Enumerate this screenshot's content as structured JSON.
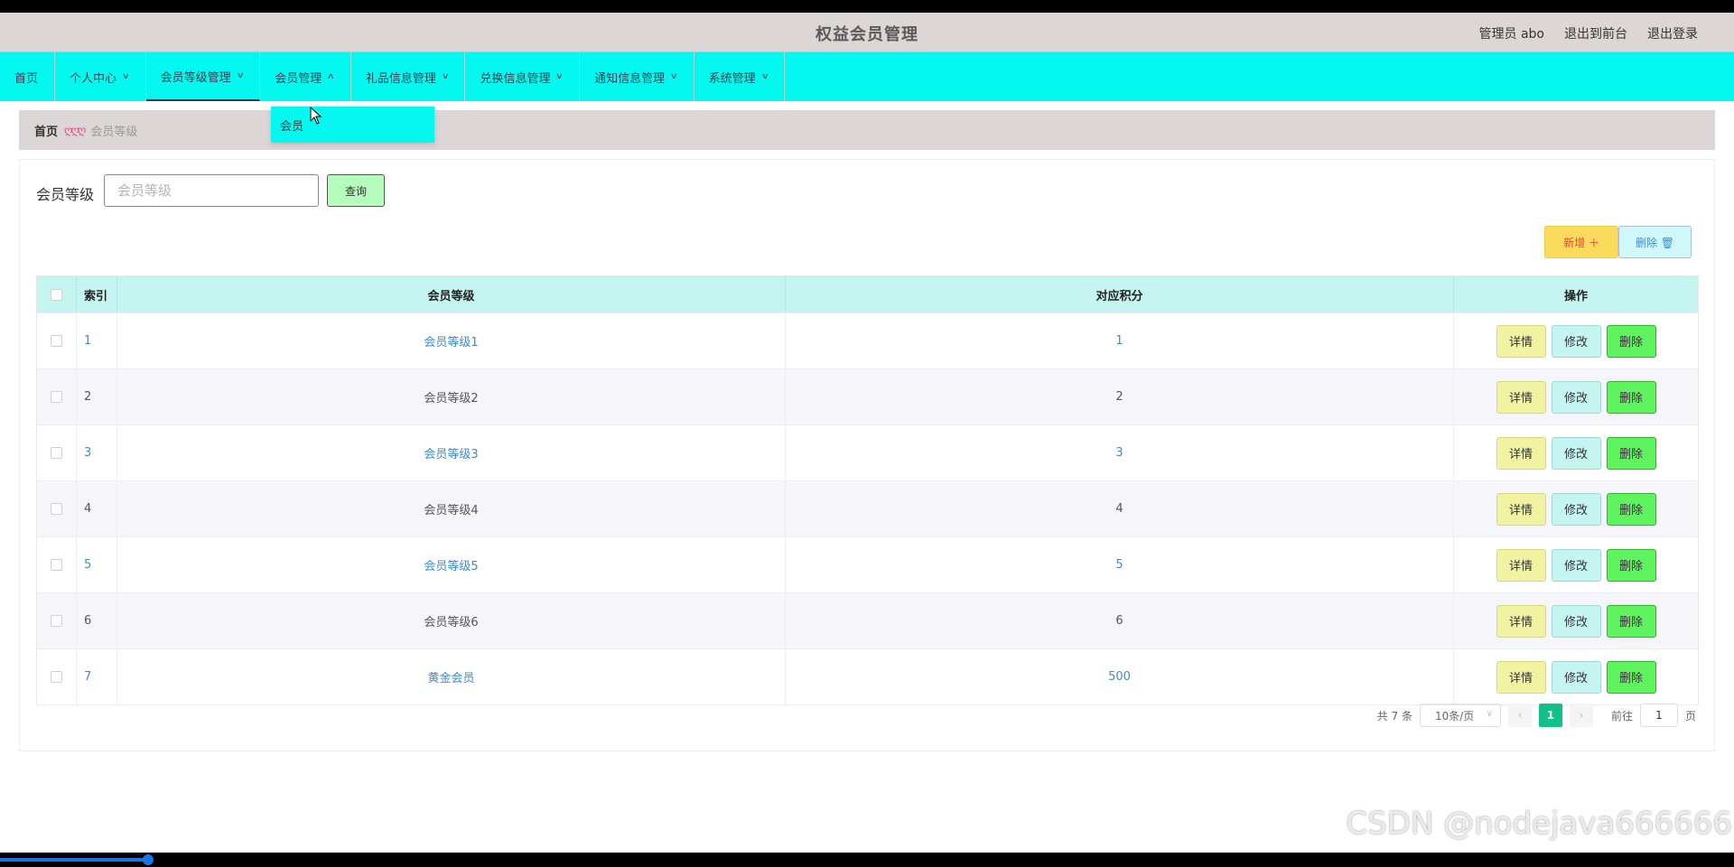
{
  "header": {
    "title": "权益会员管理",
    "admin": "管理员 abo",
    "to_front": "退出到前台",
    "logout": "退出登录"
  },
  "nav": {
    "items": [
      {
        "label": "首页"
      },
      {
        "label": "个人中心"
      },
      {
        "label": "会员等级管理"
      },
      {
        "label": "会员管理"
      },
      {
        "label": "礼品信息管理"
      },
      {
        "label": "兑换信息管理"
      },
      {
        "label": "通知信息管理"
      },
      {
        "label": "系统管理"
      }
    ],
    "dropdown_item": "会员"
  },
  "breadcrumb": {
    "home": "首页",
    "separator": "ღღღ",
    "current": "会员等级"
  },
  "search": {
    "label": "会员等级",
    "placeholder": "会员等级",
    "query_button": "查询"
  },
  "actions": {
    "add": "新增 ＋",
    "delete": "删除 🗑"
  },
  "table": {
    "headers": [
      "索引",
      "会员等级",
      "对应积分",
      "操作"
    ],
    "rows": [
      {
        "index": "1",
        "level": "会员等级1",
        "points": "1"
      },
      {
        "index": "2",
        "level": "会员等级2",
        "points": "2"
      },
      {
        "index": "3",
        "level": "会员等级3",
        "points": "3"
      },
      {
        "index": "4",
        "level": "会员等级4",
        "points": "4"
      },
      {
        "index": "5",
        "level": "会员等级5",
        "points": "5"
      },
      {
        "index": "6",
        "level": "会员等级6",
        "points": "6"
      },
      {
        "index": "7",
        "level": "黄金会员",
        "points": "500"
      }
    ],
    "op_detail": "详情",
    "op_edit": "修改",
    "op_delete": "删除"
  },
  "pagination": {
    "total": "共 7 条",
    "page_size": "10条/页",
    "current": "1",
    "goto": "前往",
    "goto_value": "1",
    "page_unit": "页"
  },
  "watermark": "CSDN @nodejava666666",
  "colors": {
    "nav_bg": "#05f8f0",
    "header_bg": "#ddd6d6",
    "link": "#3b8ad8",
    "page_active": "#13c08a"
  }
}
